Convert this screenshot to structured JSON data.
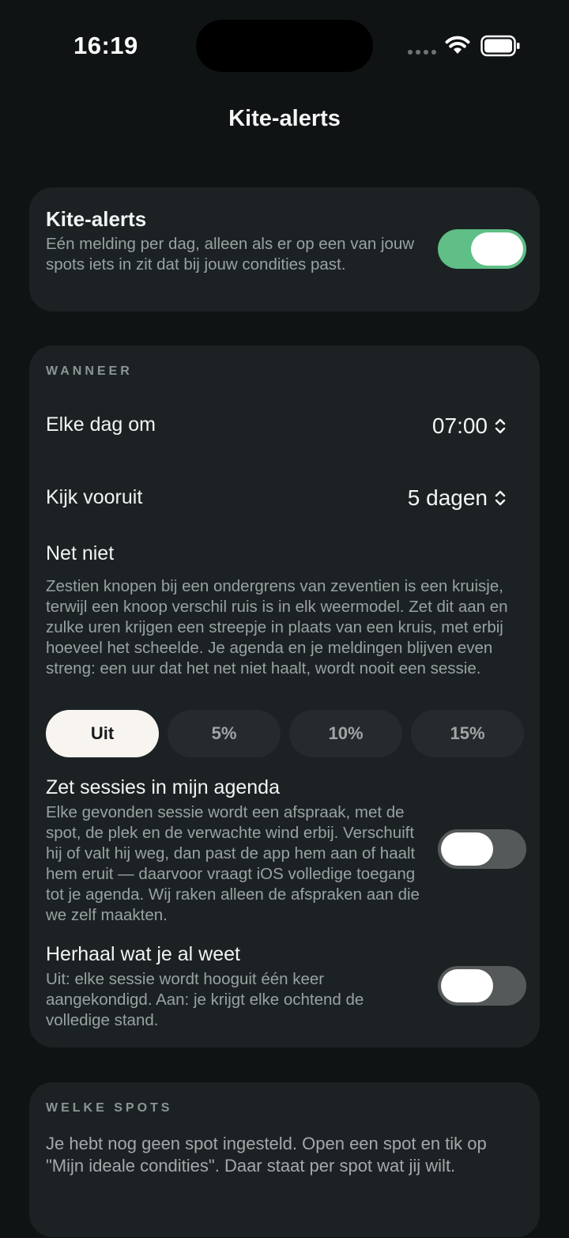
{
  "status_bar": {
    "time": "16:19"
  },
  "nav": {
    "title": "Kite-alerts"
  },
  "alerts": {
    "title": "Kite-alerts",
    "description": "Eén melding per dag, alleen als er op een van jouw spots iets in zit dat bij jouw condities past.",
    "enabled": true
  },
  "when": {
    "section_label": "WANNEER",
    "daily": {
      "label": "Elke dag om",
      "value": "07:00"
    },
    "lookahead": {
      "label": "Kijk vooruit",
      "value": "5 dagen"
    },
    "near_miss": {
      "title": "Net niet",
      "description": "Zestien knopen bij een ondergrens van zeventien is een kruisje, terwijl een knoop verschil ruis is in elk weermodel. Zet dit aan en zulke uren krijgen een streepje in plaats van een kruis, met erbij hoeveel het scheelde. Je agenda en je meldingen blijven even streng: een uur dat het net niet haalt, wordt nooit een sessie.",
      "options": [
        "Uit",
        "5%",
        "10%",
        "15%"
      ],
      "selected": "Uit"
    },
    "calendar": {
      "title": "Zet sessies in mijn agenda",
      "description": "Elke gevonden sessie wordt een afspraak, met de spot, de plek en de verwachte wind erbij. Verschuift hij of valt hij weg, dan past de app hem aan of haalt hem eruit — daarvoor vraagt iOS volledige toegang tot je agenda. Wij raken alleen de afspraken aan die we zelf maakten.",
      "enabled": false
    },
    "repeat": {
      "title": "Herhaal wat je al weet",
      "description": "Uit: elke sessie wordt hooguit één keer aangekondigd. Aan: je krijgt elke ochtend de volledige stand.",
      "enabled": false
    }
  },
  "spots": {
    "section_label": "WELKE SPOTS",
    "empty_text": "Je hebt nog geen spot ingesteld. Open een spot en tik op \"Mijn ideale condities\". Daar staat per spot wat jij wilt."
  },
  "colors": {
    "background": "#101314",
    "card": "#1c2223",
    "toggle_on": "#5fbf86",
    "toggle_off": "#55595a",
    "segment_selected": "#f8f5f0",
    "segment_unselected": "#252b2c"
  },
  "icons": [
    "wifi-icon",
    "battery-icon",
    "chevron-up-down-icon"
  ]
}
